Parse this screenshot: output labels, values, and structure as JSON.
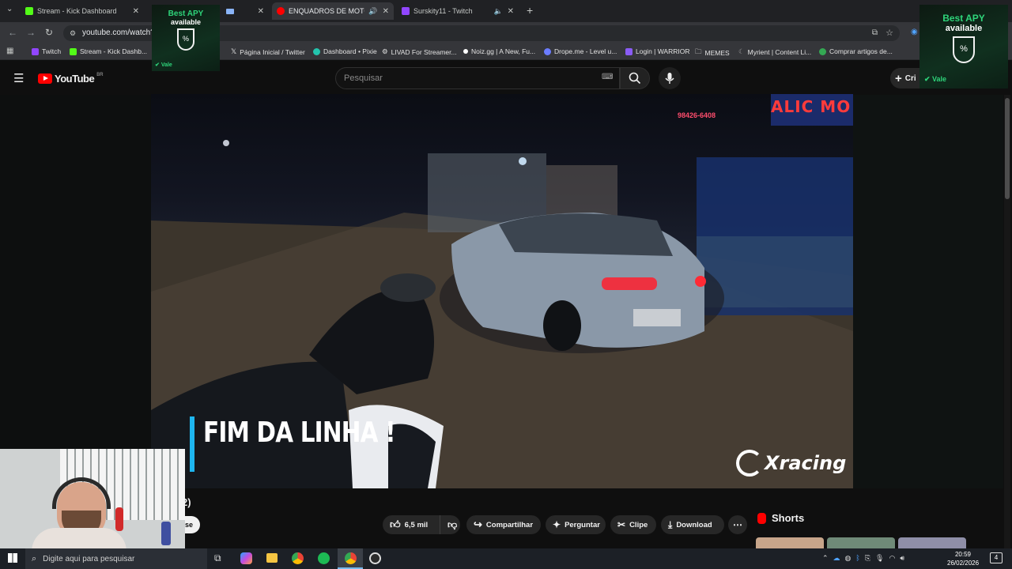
{
  "tabs": [
    {
      "label": "Stream - Kick Dashboard",
      "color": "#53fc18"
    },
    {
      "label": "ENQUADROS DE MOTO (E",
      "color": "#ff0000",
      "active": true
    },
    {
      "label": "Surskity11 - Twitch",
      "color": "#9146ff"
    }
  ],
  "new_tab": "+",
  "address": "youtube.com/watch?",
  "bookmarks": [
    {
      "label": "Twitch",
      "color": "#9146ff"
    },
    {
      "label": "Stream - Kick Dashb...",
      "color": "#53fc18"
    },
    {
      "label": "Página Inicial / Twitter",
      "color": "#ffffff"
    },
    {
      "label": "Dashboard • Pixie",
      "color": "#23c4ad"
    },
    {
      "label": "LIVAD For Streamer...",
      "color": "#dddddd"
    },
    {
      "label": "Noiz.gg | A New, Fu...",
      "color": "#ffffff"
    },
    {
      "label": "Drope.me - Level u...",
      "color": "#6b7cff"
    },
    {
      "label": "Login | WARRIOR",
      "color": "#8a5cf6"
    },
    {
      "label": "MEMES",
      "color": "#c4c7c5"
    },
    {
      "label": "Myrient | Content Li...",
      "color": "#999999"
    },
    {
      "label": "Comprar artigos de...",
      "color": "#34a853"
    }
  ],
  "youtube": {
    "logo": "YouTube",
    "region": "BR",
    "search_placeholder": "Pesquisar",
    "create_label": "Cri"
  },
  "video": {
    "caption": "FIM DA LINHA !",
    "sign_text": "98426-6408",
    "store_sign": "ALIC MO",
    "watermark": "Xracing"
  },
  "below": {
    "partial_title": "2)",
    "partial_button": "se"
  },
  "actions": {
    "likes": "6,5 mil",
    "share": "Compartilhar",
    "ask": "Perguntar",
    "clip": "Clipe",
    "download": "Download"
  },
  "shorts": {
    "label": "Shorts"
  },
  "ads": {
    "line1": "Best APY",
    "line2": "available",
    "brand": "Vale"
  },
  "taskbar": {
    "search_placeholder": "Digite aqui para pesquisar",
    "time": "20:59",
    "date": "26/02/2026",
    "notifications": "4"
  }
}
